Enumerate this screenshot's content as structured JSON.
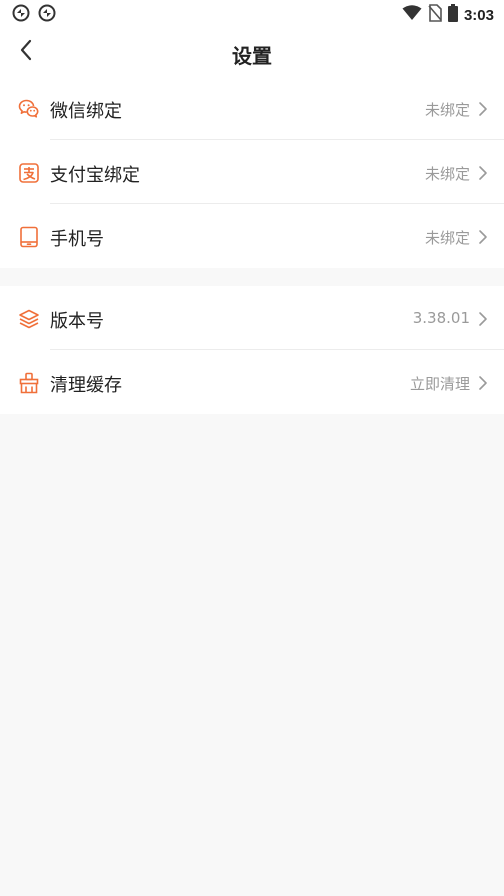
{
  "status_bar": {
    "time": "3:03",
    "left_icons": [
      "sync-app-icon",
      "sync-app-icon"
    ],
    "right_icons": [
      "wifi-icon",
      "no-sim-icon",
      "battery-icon"
    ]
  },
  "header": {
    "title": "设置",
    "back_icon": "chevron-left-icon"
  },
  "group1": {
    "items": [
      {
        "label": "微信绑定",
        "value": "未绑定",
        "icon": "wechat-icon"
      },
      {
        "label": "支付宝绑定",
        "value": "未绑定",
        "icon": "alipay-icon"
      },
      {
        "label": "手机号",
        "value": "未绑定",
        "icon": "phone-icon"
      }
    ]
  },
  "group2": {
    "items": [
      {
        "label": "版本号",
        "value": "3.38.01",
        "icon": "layers-icon"
      },
      {
        "label": "清理缓存",
        "value": "立即清理",
        "icon": "broom-icon"
      }
    ]
  },
  "colors": {
    "accent": "#f0703a",
    "background": "#f8f8f8",
    "card": "#ffffff",
    "value_text": "#9a9a9a",
    "divider": "#ececec"
  }
}
